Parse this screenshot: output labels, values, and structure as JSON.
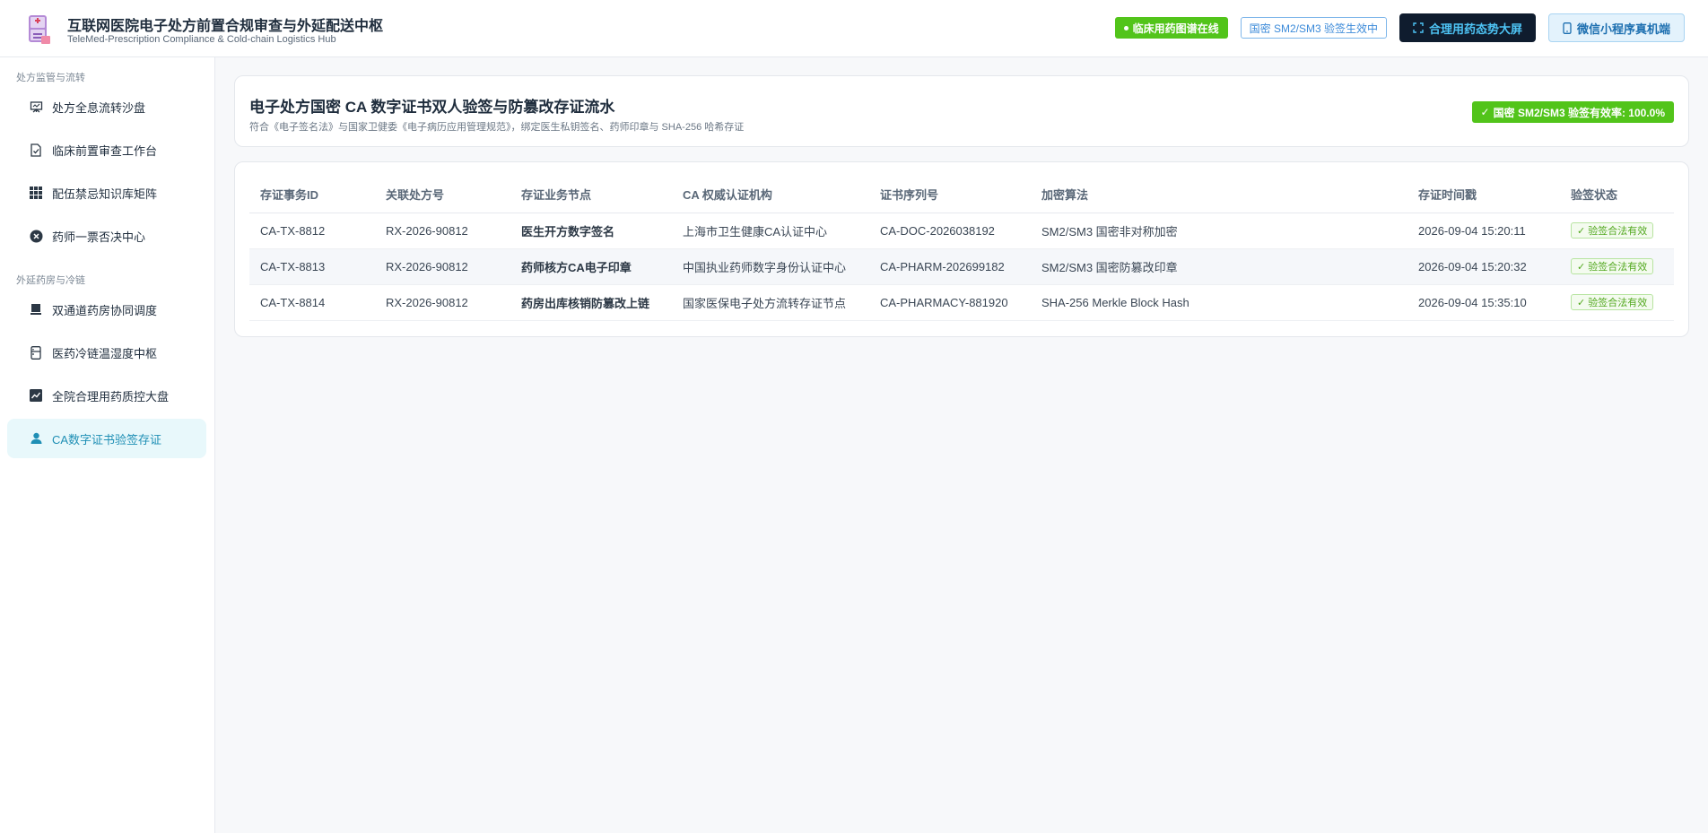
{
  "header": {
    "title": "互联网医院电子处方前置合规审查与外延配送中枢",
    "subtitle": "TeleMed-Prescription Compliance & Cold-chain Logistics Hub",
    "logo_icon": "pharmacy-fridge-icon",
    "online_badge": "临床用药图谱在线",
    "sm_badge": "国密 SM2/SM3 验签生效中",
    "bigscreen_button": "合理用药态势大屏",
    "miniapp_button": "微信小程序真机端"
  },
  "sidebar": {
    "groups": [
      {
        "label": "处方监管与流转",
        "items": [
          {
            "label": "处方全息流转沙盘",
            "icon": "sandbox-board-icon"
          },
          {
            "label": "临床前置审查工作台",
            "icon": "document-check-icon"
          },
          {
            "label": "配伍禁忌知识库矩阵",
            "icon": "grid-matrix-icon"
          },
          {
            "label": "药师一票否决中心",
            "icon": "veto-x-circle-icon"
          }
        ]
      },
      {
        "label": "外延药房与冷链",
        "items": [
          {
            "label": "双通道药房协同调度",
            "icon": "pharmacy-store-icon"
          },
          {
            "label": "医药冷链温湿度中枢",
            "icon": "fridge-icon"
          },
          {
            "label": "全院合理用药质控大盘",
            "icon": "trend-chart-icon"
          },
          {
            "label": "CA数字证书验签存证",
            "icon": "user-cert-icon",
            "active": true
          }
        ]
      }
    ]
  },
  "main": {
    "title": "电子处方国密 CA 数字证书双人验签与防篡改存证流水",
    "subtitle": "符合《电子签名法》与国家卫健委《电子病历应用管理规范》，绑定医生私钥签名、药师印章与 SHA-256 哈希存证",
    "rate_badge": "国密 SM2/SM3 验签有效率: 100.0%",
    "table": {
      "columns": [
        "存证事务ID",
        "关联处方号",
        "存证业务节点",
        "CA 权威认证机构",
        "证书序列号",
        "加密算法",
        "存证时间戳",
        "验签状态"
      ],
      "rows": [
        [
          "CA-TX-8812",
          "RX-2026-90812",
          "医生开方数字签名",
          "上海市卫生健康CA认证中心",
          "CA-DOC-2026038192",
          "SM2/SM3 国密非对称加密",
          "2026-09-04 15:20:11",
          "验签合法有效"
        ],
        [
          "CA-TX-8813",
          "RX-2026-90812",
          "药师核方CA电子印章",
          "中国执业药师数字身份认证中心",
          "CA-PHARM-202699182",
          "SM2/SM3 国密防篡改印章",
          "2026-09-04 15:20:32",
          "验签合法有效"
        ],
        [
          "CA-TX-8814",
          "RX-2026-90812",
          "药房出库核销防篡改上链",
          "国家医保电子处方流转存证节点",
          "CA-PHARMACY-881920",
          "SHA-256 Merkle Block Hash",
          "2026-09-04 15:35:10",
          "验签合法有效"
        ]
      ]
    }
  },
  "colors": {
    "accent_green": "#52c41a",
    "dark_button": "#0f1c2e",
    "active_nav": "#1f8fb5"
  }
}
